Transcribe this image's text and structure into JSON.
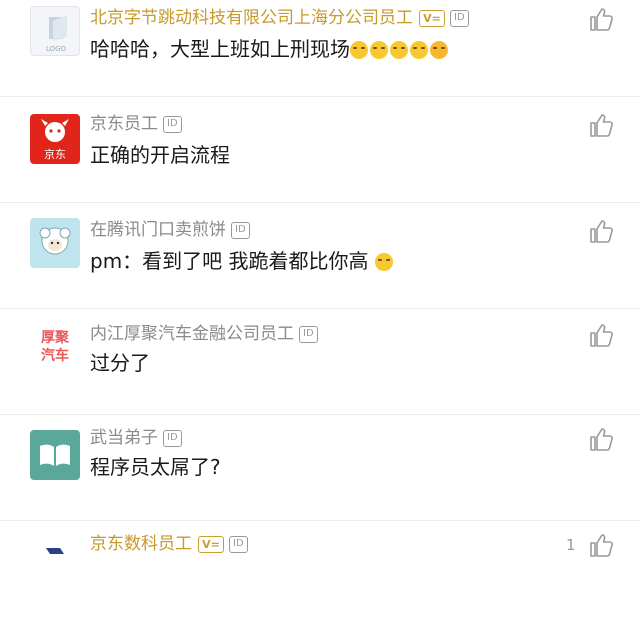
{
  "comments": [
    {
      "username": "北京字节跳动科技有限公司上海分公司员工",
      "verified_badge": "V=",
      "id_badge": "ID",
      "text": "哈哈哈，大型上班如上刑现场",
      "avatar": {
        "type": "logo-placeholder",
        "label": "LOGO"
      },
      "emojis": [
        "grin-emoji",
        "grin-emoji",
        "grin-emoji",
        "grin-emoji",
        "shock-emoji"
      ]
    },
    {
      "username": "京东员工",
      "id_badge": "ID",
      "text": "正确的开启流程",
      "avatar": {
        "type": "jd",
        "label": "京东",
        "color": "#e1251b"
      }
    },
    {
      "username": "在腾讯门口卖煎饼",
      "id_badge": "ID",
      "text": "pm：看到了吧 我跪着都比你高",
      "avatar": {
        "type": "sheep",
        "color": "#bfe4ee"
      },
      "emojis": [
        "grin-emoji"
      ]
    },
    {
      "username": "内江厚聚汽车金融公司员工",
      "id_badge": "ID",
      "text": "过分了",
      "avatar": {
        "type": "text-logo",
        "line1": "厚聚",
        "line2": "汽车",
        "color": "#e85a5a"
      }
    },
    {
      "username": "武当弟子",
      "id_badge": "ID",
      "text": "程序员太屌了?",
      "avatar": {
        "type": "book",
        "color": "#5aa89a"
      }
    },
    {
      "username": "京东数科员工",
      "verified_badge": "V=",
      "id_badge": "ID",
      "like_count": "1"
    }
  ],
  "colors": {
    "gold_username": "#c79a2a",
    "gray_username": "#8a8a8a",
    "text": "#1a1a1a",
    "divider": "#eeeeee"
  }
}
